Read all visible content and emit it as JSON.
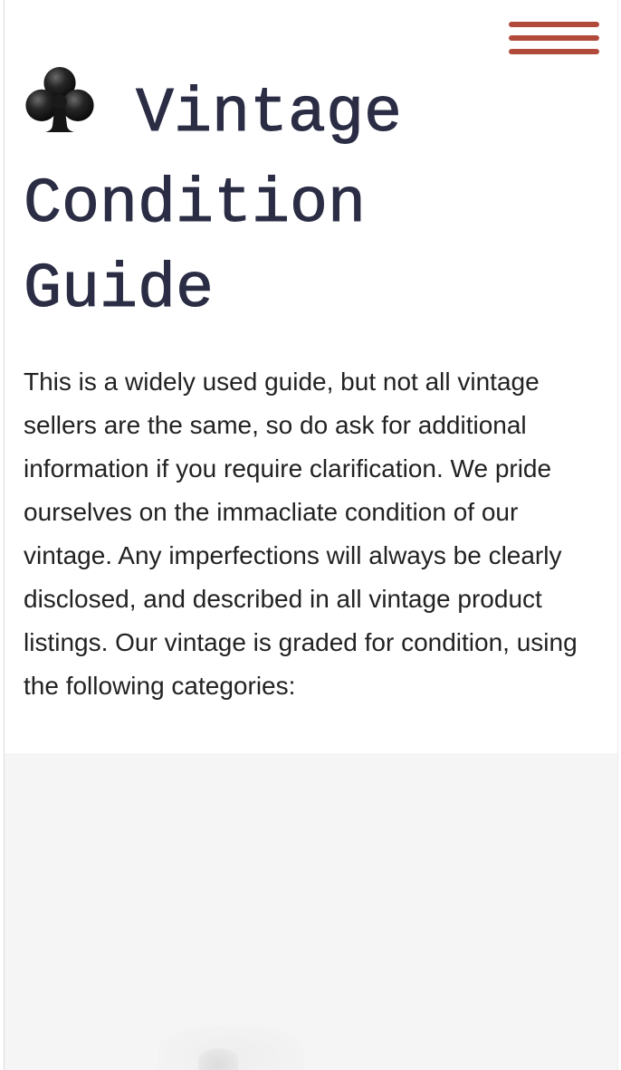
{
  "header": {
    "menu_icon": "hamburger-menu-icon",
    "menu_color": "#b24a3c"
  },
  "guide": {
    "title_icon": "club-suit-icon",
    "title": "Vintage Condition Guide",
    "intro": "This is a widely used guide, but not all vintage sellers are the same, so do ask for additional information if you require clarification. We pride ourselves on the immacliate condition of our vintage. Any imperfections will always be clearly disclosed, and described in all vintage product listings. Our vintage is graded for condition, using the following categories:"
  },
  "colors": {
    "title_text": "#2b2d45",
    "body_text": "#222222",
    "gallery_background": "#f5f5f5"
  }
}
